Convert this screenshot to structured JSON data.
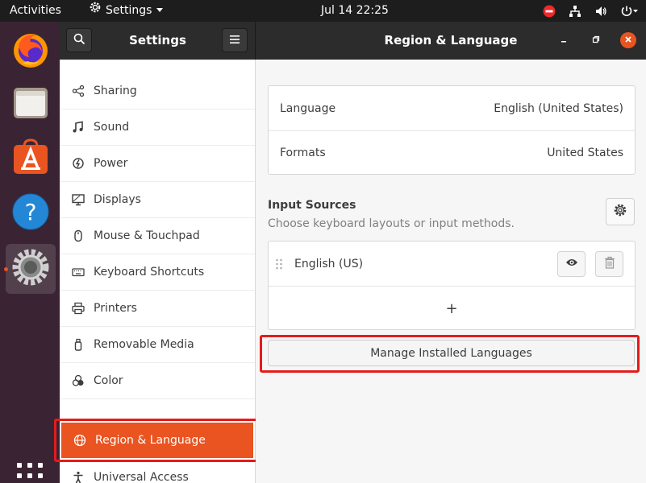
{
  "topbar": {
    "activities": "Activities",
    "app_menu_label": "Settings",
    "clock": "Jul 14  22:25"
  },
  "dock": {
    "apps": [
      "firefox",
      "files",
      "software",
      "help",
      "settings"
    ],
    "active_app": "settings"
  },
  "header": {
    "sidebar_title": "Settings",
    "panel_title": "Region & Language"
  },
  "sidebar": {
    "items": [
      {
        "label": "Sharing",
        "icon": "share-icon"
      },
      {
        "label": "Sound",
        "icon": "music-note-icon"
      },
      {
        "label": "Power",
        "icon": "power-icon"
      },
      {
        "label": "Displays",
        "icon": "display-icon"
      },
      {
        "label": "Mouse & Touchpad",
        "icon": "mouse-icon"
      },
      {
        "label": "Keyboard Shortcuts",
        "icon": "keyboard-icon"
      },
      {
        "label": "Printers",
        "icon": "printer-icon"
      },
      {
        "label": "Removable Media",
        "icon": "usb-drive-icon"
      },
      {
        "label": "Color",
        "icon": "color-icon"
      },
      {
        "label": "Region & Language",
        "icon": "globe-icon",
        "selected": true
      },
      {
        "label": "Universal Access",
        "icon": "accessibility-icon"
      }
    ]
  },
  "region": {
    "language_label": "Language",
    "language_value": "English (United States)",
    "formats_label": "Formats",
    "formats_value": "United States"
  },
  "input_sources": {
    "title": "Input Sources",
    "subtitle": "Choose keyboard layouts or input methods.",
    "items": [
      {
        "label": "English (US)"
      }
    ],
    "add_symbol": "+"
  },
  "manage_button": "Manage Installed Languages",
  "colors": {
    "accent": "#e95420",
    "highlight": "#e41b1b"
  }
}
